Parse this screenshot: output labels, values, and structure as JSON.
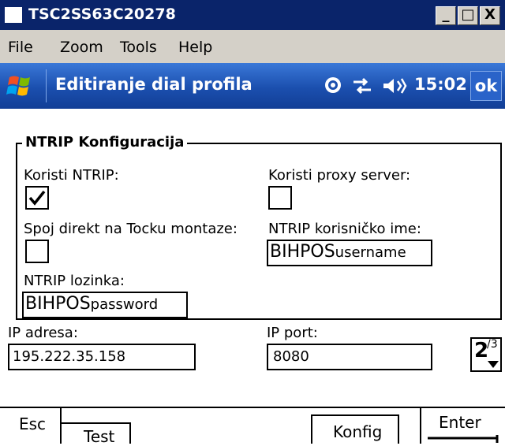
{
  "window": {
    "title": "TSC2SS63C20278",
    "minimize": "_",
    "maximize": "□",
    "close": "X"
  },
  "menu": {
    "items": [
      "File",
      "Zoom",
      "Tools",
      "Help"
    ]
  },
  "device_bar": {
    "title": "Editiranje dial profila",
    "time": "15:02",
    "ok": "ok"
  },
  "group": {
    "title": "NTRIP Konfiguracija",
    "use_ntrip_label": "Koristi NTRIP:",
    "use_ntrip_checked": true,
    "use_proxy_label": "Koristi proxy server:",
    "use_proxy_checked": false,
    "direct_label": "Spoj direkt na Tocku montaze:",
    "direct_checked": false,
    "username_label": "NTRIP korisničko ime:",
    "username_value": "BIHPOS",
    "username_hint": "username",
    "password_label": "NTRIP lozinka:",
    "password_value": "BIHPOS",
    "password_hint": "password"
  },
  "ip": {
    "address_label": "IP adresa:",
    "address_value": "195.222.35.158",
    "port_label": "IP port:",
    "port_value": "8080"
  },
  "page_indicator": {
    "current": "2",
    "total": "/3"
  },
  "softkeys": {
    "esc": "Esc",
    "test": "Test",
    "konfig": "Konfig",
    "enter": "Enter"
  }
}
